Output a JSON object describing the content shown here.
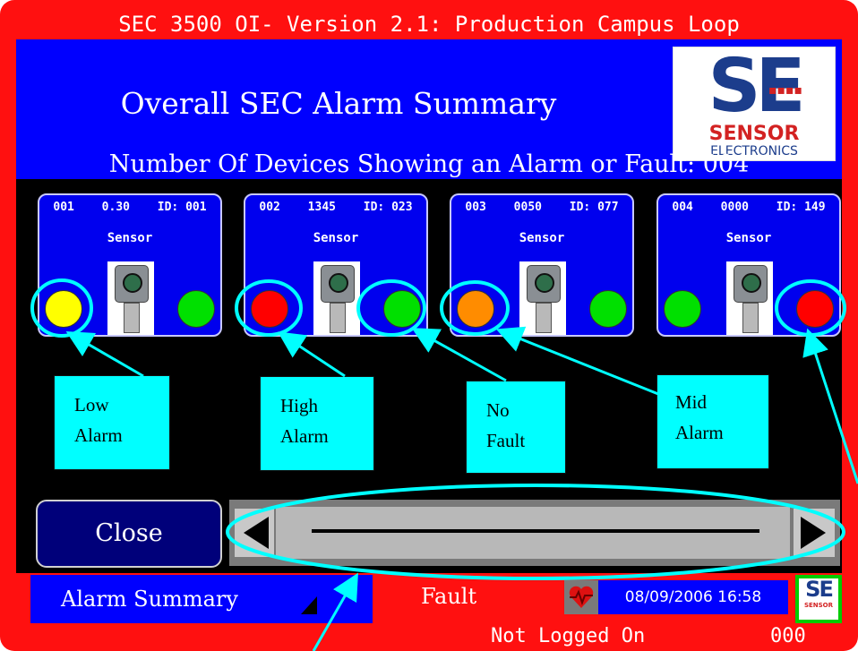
{
  "title": "SEC 3500 OI- Version 2.1: Production Campus Loop",
  "heading": "Overall SEC Alarm Summary",
  "logo": {
    "big": "SE",
    "dots": "▪▪▪▪",
    "word1": "SENSOR",
    "word2": "ELECTRONICS"
  },
  "device_count_text": "Number Of Devices Showing an Alarm or Fault: 004",
  "devices": [
    {
      "num": "001",
      "reading": "0.30",
      "id": "ID: 001",
      "label": "Sensor",
      "left_lamp": "yellow",
      "right_lamp": "green"
    },
    {
      "num": "002",
      "reading": "1345",
      "id": "ID: 023",
      "label": "Sensor",
      "left_lamp": "red",
      "right_lamp": "green"
    },
    {
      "num": "003",
      "reading": "0050",
      "id": "ID: 077",
      "label": "Sensor",
      "left_lamp": "orange",
      "right_lamp": "green"
    },
    {
      "num": "004",
      "reading": "0000",
      "id": "ID: 149",
      "label": "Sensor",
      "left_lamp": "green",
      "right_lamp": "red"
    }
  ],
  "lamp_colors": {
    "yellow": "#ffff00",
    "red": "#ff0000",
    "green": "#00e000",
    "orange": "#ff8c00"
  },
  "callouts": {
    "low": [
      "Low",
      "Alarm"
    ],
    "high": [
      "High",
      "Alarm"
    ],
    "nofault": [
      "No",
      "Fault"
    ],
    "mid": [
      "Mid",
      "Alarm"
    ]
  },
  "close_label": "Close",
  "status": {
    "alarm_summary": "Alarm Summary",
    "fault": "Fault",
    "datetime": "08/09/2006 16:58",
    "login": "Not Logged On",
    "code": "000",
    "mini_logo": "SE",
    "mini_word": "SENSOR"
  },
  "colors": {
    "frame": "#ff1010",
    "panel": "#0000ff",
    "annotation": "#00ffff"
  }
}
